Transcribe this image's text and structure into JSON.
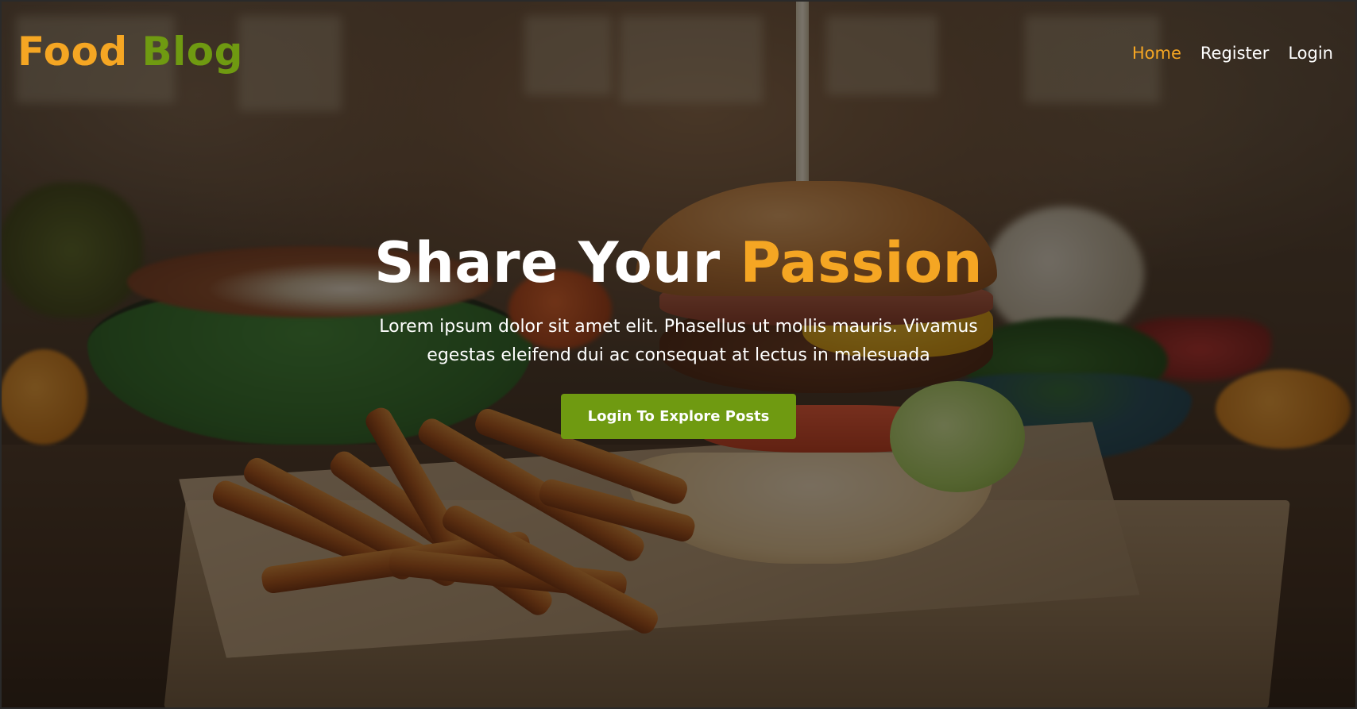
{
  "brand": {
    "word1": "Food",
    "word2": "Blog",
    "color_word1": "#f5a623",
    "color_word2": "#6f9a11"
  },
  "nav": {
    "items": [
      {
        "label": "Home",
        "active": true
      },
      {
        "label": "Register",
        "active": false
      },
      {
        "label": "Login",
        "active": false
      }
    ],
    "active_color": "#f5a623"
  },
  "hero": {
    "headline_part1": "Share Your",
    "headline_highlight": "Passion",
    "description": "Lorem ipsum dolor sit amet elit. Phasellus ut mollis mauris. Vivamus egestas eleifend dui ac consequat at lectus in malesuada",
    "cta_label": "Login To Explore Posts",
    "cta_color": "#6f9a11"
  }
}
